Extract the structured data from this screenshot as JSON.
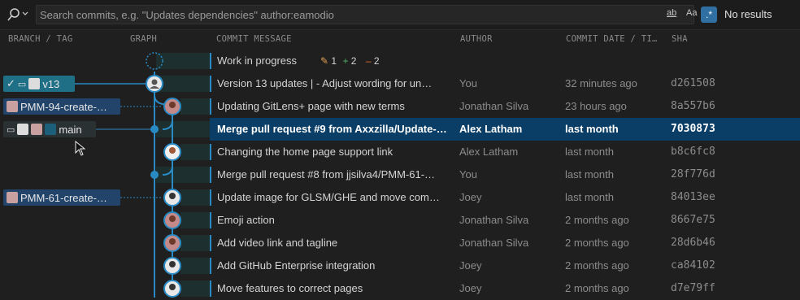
{
  "search": {
    "placeholder": "Search commits, e.g. \"Updates dependencies\" author:eamodio",
    "opt_match_word": "ab",
    "opt_match_case": "Aa",
    "opt_regex": ".*",
    "result_text": "No results"
  },
  "columns": {
    "branch_tag": "BRANCH / TAG",
    "graph": "GRAPH",
    "message": "COMMIT MESSAGE",
    "author": "AUTHOR",
    "date": "COMMIT DATE / TI…",
    "sha": "SHA"
  },
  "wip": {
    "message": "Work in progress",
    "modified_icon": "pencil-icon",
    "modified": "1",
    "added_icon": "plus-icon",
    "added": "2",
    "deleted_icon": "minus-icon",
    "deleted": "2"
  },
  "refs": {
    "tag_v13": "v13",
    "branch_pmm94": "PMM-94-create-…",
    "branch_main": "main",
    "branch_pmm61": "PMM-61-create-…"
  },
  "commits": [
    {
      "message": "Version 13 updates | - Adjust wording for un…",
      "author": "You",
      "date": "32 minutes ago",
      "sha": "d261508"
    },
    {
      "message": "Updating GitLens+ page with new terms",
      "author": "Jonathan Silva",
      "date": "23 hours ago",
      "sha": "8a557b6"
    },
    {
      "message": "Merge pull request #9 from Axxzilla/Update-…",
      "author": "Alex Latham",
      "date": "last month",
      "sha": "7030873"
    },
    {
      "message": "Changing the home page support link",
      "author": "Alex Latham",
      "date": "last month",
      "sha": "b8c6fc8"
    },
    {
      "message": "Merge pull request #8 from jjsilva4/PMM-61-…",
      "author": "You",
      "date": "last month",
      "sha": "28f776d"
    },
    {
      "message": "Update image for GLSM/GHE and move com…",
      "author": "Joey",
      "date": "last month",
      "sha": "84013ee"
    },
    {
      "message": "Emoji action",
      "author": "Jonathan Silva",
      "date": "2 months ago",
      "sha": "8667e75"
    },
    {
      "message": "Add video link and tagline",
      "author": "Jonathan Silva",
      "date": "2 months ago",
      "sha": "28d6b46"
    },
    {
      "message": "Add GitHub Enterprise integration",
      "author": "Joey",
      "date": "2 months ago",
      "sha": "ca84102"
    },
    {
      "message": "Move features to correct pages",
      "author": "Joey",
      "date": "2 months ago",
      "sha": "d7e79ff"
    }
  ],
  "colors": {
    "accent": "#2a8ac4",
    "selected_row": "#0a3e66",
    "branch_chip": "#22446b",
    "tag_chip": "#1f6f86"
  }
}
